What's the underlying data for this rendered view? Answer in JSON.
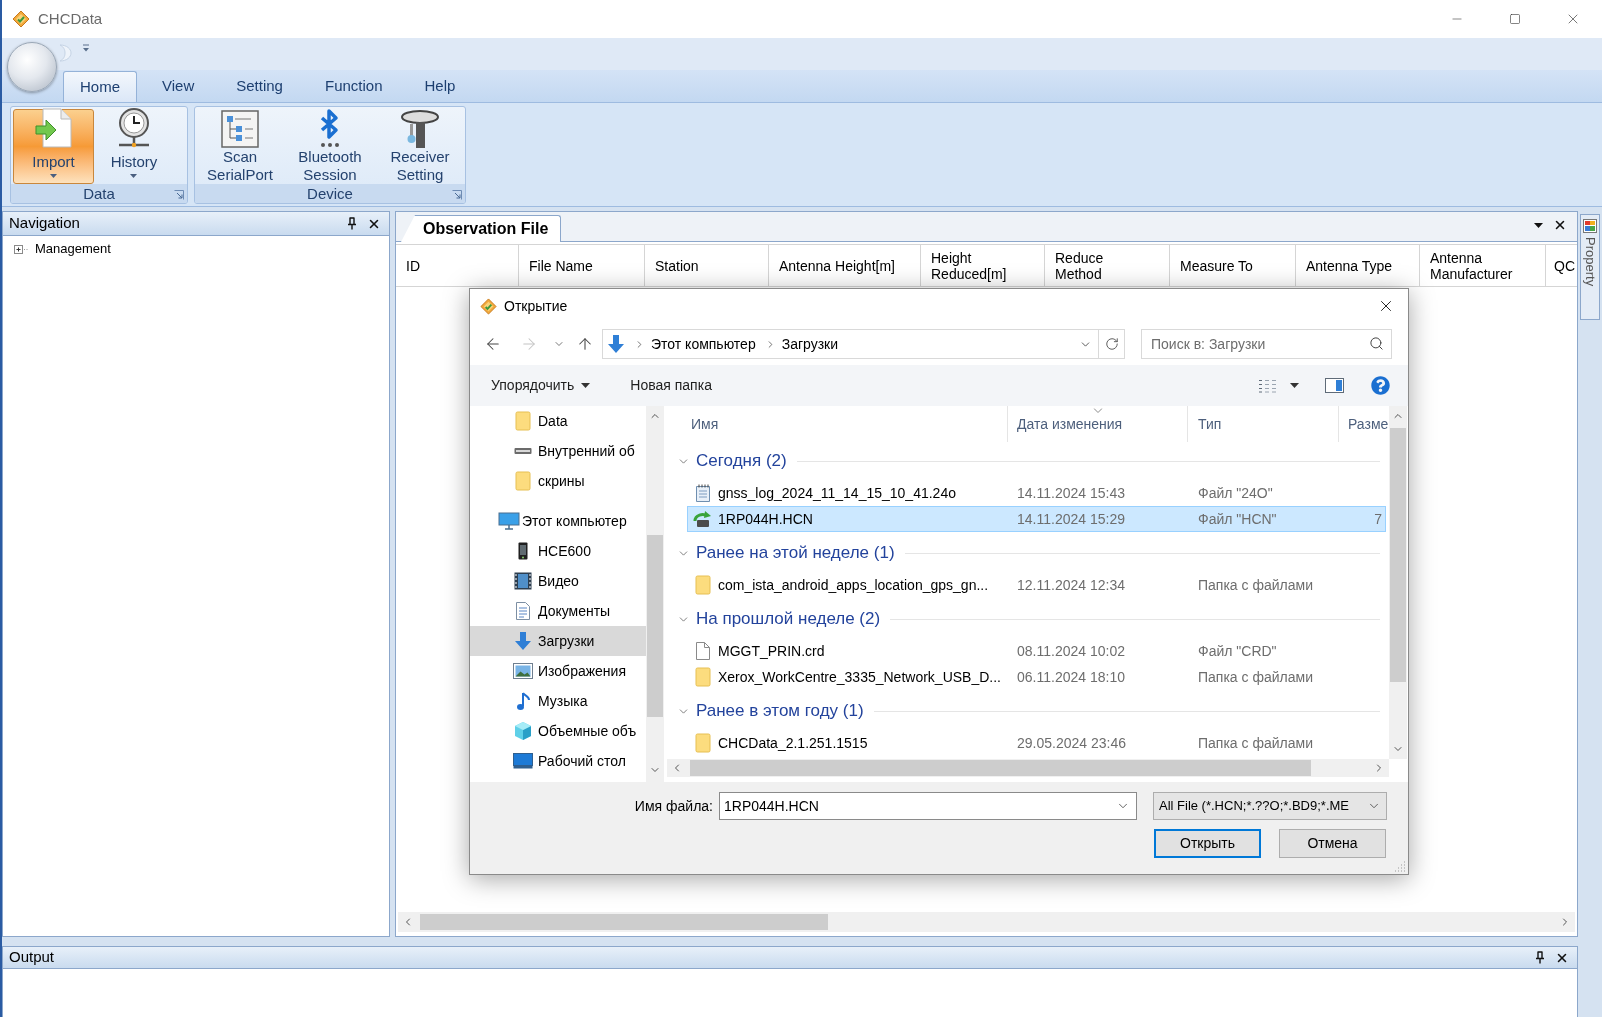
{
  "window": {
    "title": "CHCData"
  },
  "ribbon": {
    "tabs": [
      {
        "label": "Home",
        "selected": true
      },
      {
        "label": "View",
        "selected": false
      },
      {
        "label": "Setting",
        "selected": false
      },
      {
        "label": "Function",
        "selected": false
      },
      {
        "label": "Help",
        "selected": false
      }
    ],
    "groups": [
      {
        "label": "Data",
        "buttons": [
          {
            "kind": "import",
            "label": "Import",
            "dropdown": true,
            "selected": true
          },
          {
            "kind": "history",
            "label": "History",
            "dropdown": true,
            "selected": false
          }
        ]
      },
      {
        "label": "Device",
        "buttons": [
          {
            "kind": "serial",
            "label": "Scan SerialPort",
            "dropdown": false,
            "selected": false
          },
          {
            "kind": "bluetooth",
            "label": "Bluetooth Session",
            "dropdown": false,
            "selected": false
          },
          {
            "kind": "receiver",
            "label": "Receiver Setting",
            "dropdown": false,
            "selected": false
          }
        ]
      }
    ]
  },
  "navigation": {
    "title": "Navigation",
    "tree": [
      {
        "label": "Management",
        "expanded": false
      }
    ]
  },
  "document": {
    "tabs": [
      {
        "label": "Observation File",
        "selected": true
      }
    ],
    "table": {
      "columns": [
        "ID",
        "File Name",
        "Station",
        "Antenna Height[m]",
        "Height Reduced[m]",
        "Reduce Method",
        "Measure To",
        "Antenna Type",
        "Antenna Manufacturer",
        "QC"
      ]
    }
  },
  "property_tab": {
    "label": "Property"
  },
  "output": {
    "title": "Output"
  },
  "open_dialog": {
    "title": "Открытие",
    "history_buttons": [
      {
        "kind": "back",
        "disabled": false
      },
      {
        "kind": "forward",
        "disabled": true
      }
    ],
    "address": {
      "path": [
        "Этот компьютер",
        "Загрузки"
      ]
    },
    "search": {
      "placeholder": "Поиск в: Загрузки"
    },
    "toolbar": {
      "organize": "Упорядочить",
      "new_folder": "Новая папка"
    },
    "nav_pane": [
      {
        "children": [
          {
            "label": "Data",
            "kind": "folder",
            "selected": false
          },
          {
            "label": "Внутренний об",
            "kind": "drive",
            "selected": false
          },
          {
            "label": "скрины",
            "kind": "folder",
            "selected": false
          }
        ]
      },
      {
        "label": "Этот компьютер",
        "kind": "computer",
        "selected": false,
        "children": [
          {
            "label": "HCE600",
            "kind": "phone",
            "selected": false
          },
          {
            "label": "Видео",
            "kind": "video",
            "selected": false
          },
          {
            "label": "Документы",
            "kind": "documents",
            "selected": false
          },
          {
            "label": "Загрузки",
            "kind": "downloads",
            "selected": true
          },
          {
            "label": "Изображения",
            "kind": "pictures",
            "selected": false
          },
          {
            "label": "Музыка",
            "kind": "music",
            "selected": false
          },
          {
            "label": "Объемные объ",
            "kind": "objects",
            "selected": false
          },
          {
            "label": "Рабочий стол",
            "kind": "desktop",
            "selected": false
          }
        ]
      }
    ],
    "columns": [
      {
        "label": "Имя",
        "sorted": false
      },
      {
        "label": "Дата изменения",
        "sorted": true
      },
      {
        "label": "Тип",
        "sorted": false
      },
      {
        "label": "Разме",
        "sorted": false
      }
    ],
    "groups": [
      {
        "label": "Сегодня (2)",
        "expanded": true,
        "files": [
          {
            "name": "gnss_log_2024_11_14_15_10_41.24o",
            "kind": "text",
            "modified": "14.11.2024 15:43",
            "type": "Файл \"24O\"",
            "selected": false
          },
          {
            "name": "1RP044H.HCN",
            "kind": "hcn",
            "modified": "14.11.2024 15:29",
            "type": "Файл \"HCN\"",
            "size": "7",
            "selected": true
          }
        ]
      },
      {
        "label": "Ранее на этой неделе (1)",
        "expanded": true,
        "files": [
          {
            "name": "com_ista_android_apps_location_gps_gn...",
            "kind": "folder",
            "modified": "12.11.2024 12:34",
            "type": "Папка с файлами",
            "selected": false
          }
        ]
      },
      {
        "label": "На прошлой неделе (2)",
        "expanded": true,
        "files": [
          {
            "name": "MGGT_PRIN.crd",
            "kind": "document",
            "modified": "08.11.2024 10:02",
            "type": "Файл \"CRD\"",
            "selected": false
          },
          {
            "name": "Xerox_WorkCentre_3335_Network_USB_D...",
            "kind": "folder",
            "modified": "06.11.2024 18:10",
            "type": "Папка с файлами",
            "selected": false
          }
        ]
      },
      {
        "label": "Ранее в этом году (1)",
        "expanded": true,
        "files": [
          {
            "name": "CHCData_2.1.251.1515",
            "kind": "folder",
            "modified": "29.05.2024 23:46",
            "type": "Папка с файлами",
            "selected": false
          }
        ]
      }
    ],
    "file_name": {
      "label": "Имя файла:",
      "value": "1RP044H.HCN"
    },
    "filter": {
      "value": "All File (*.HCN;*.??O;*.BD9;*.ME"
    },
    "buttons": [
      {
        "label": "Открыть",
        "default": true
      },
      {
        "label": "Отмена",
        "default": false
      }
    ]
  }
}
